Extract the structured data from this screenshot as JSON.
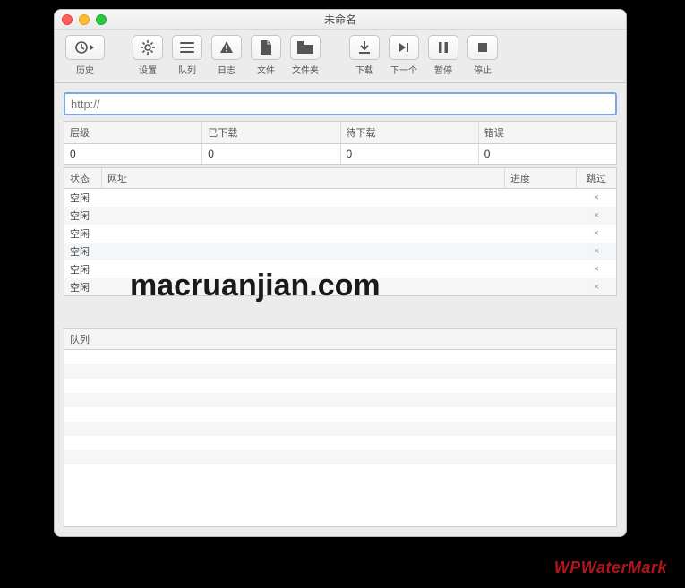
{
  "window": {
    "title": "未命名"
  },
  "toolbar": {
    "history": "历史",
    "settings": "设置",
    "queue": "队列",
    "log": "日志",
    "file": "文件",
    "folder": "文件夹",
    "download": "下载",
    "next": "下一个",
    "pause": "暂停",
    "stop": "停止"
  },
  "url": {
    "placeholder": "http://",
    "value": ""
  },
  "stats": {
    "headers": {
      "level": "层级",
      "downloaded": "已下载",
      "pending": "待下载",
      "errors": "错误"
    },
    "values": {
      "level": "0",
      "downloaded": "0",
      "pending": "0",
      "errors": "0"
    }
  },
  "list": {
    "headers": {
      "status": "状态",
      "url": "网址",
      "progress": "进度",
      "skip": "跳过"
    },
    "rows": [
      {
        "status": "空闲",
        "url": "",
        "progress": "",
        "skip": "×"
      },
      {
        "status": "空闲",
        "url": "",
        "progress": "",
        "skip": "×"
      },
      {
        "status": "空闲",
        "url": "",
        "progress": "",
        "skip": "×"
      },
      {
        "status": "空闲",
        "url": "",
        "progress": "",
        "skip": "×"
      },
      {
        "status": "空闲",
        "url": "",
        "progress": "",
        "skip": "×"
      },
      {
        "status": "空闲",
        "url": "",
        "progress": "",
        "skip": "×"
      }
    ]
  },
  "queue": {
    "header": "队列"
  },
  "watermark": {
    "center": "macruanjian.com",
    "corner": "WPWaterMark"
  }
}
